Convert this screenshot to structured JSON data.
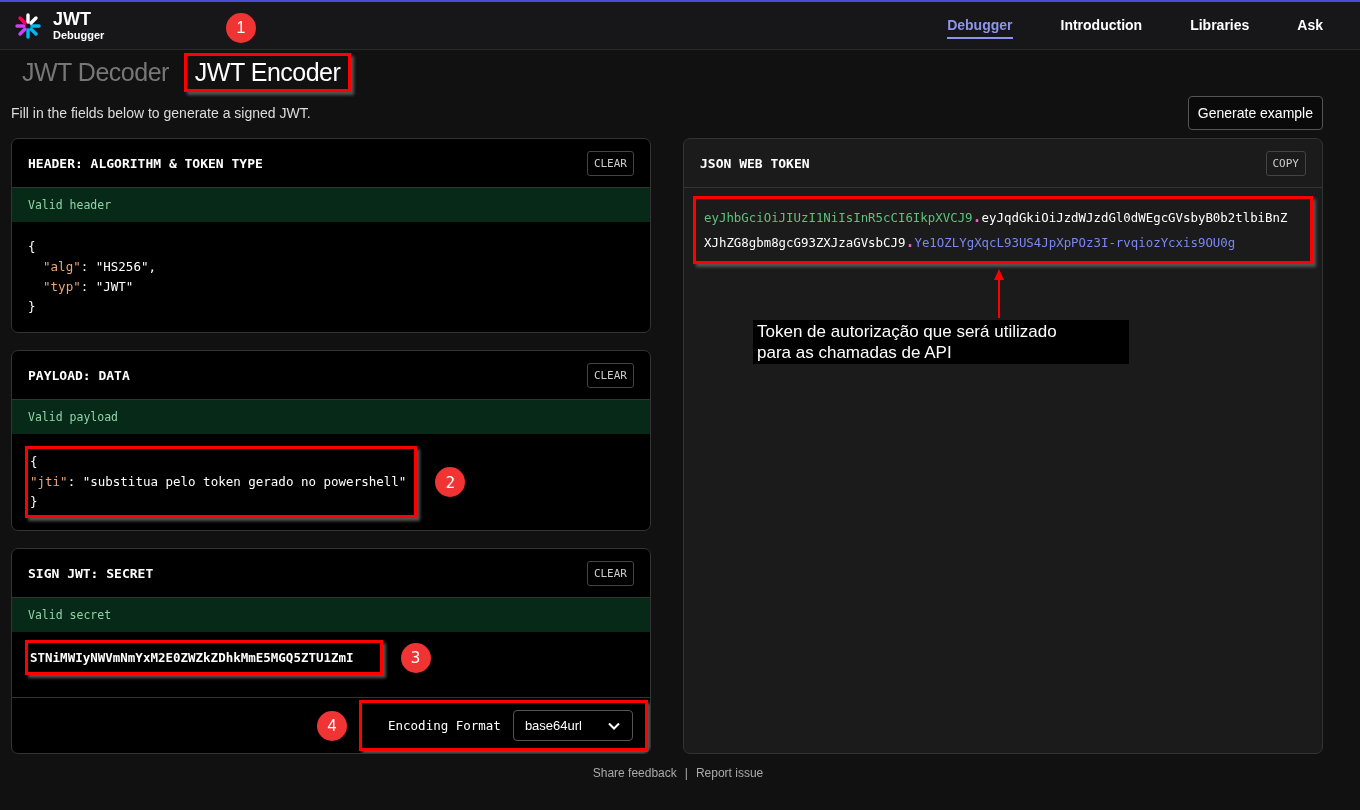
{
  "brand": {
    "title": "JWT",
    "subtitle": "Debugger"
  },
  "nav": [
    {
      "label": "Debugger",
      "selected": true
    },
    {
      "label": "Introduction",
      "selected": false
    },
    {
      "label": "Libraries",
      "selected": false
    },
    {
      "label": "Ask",
      "selected": false
    }
  ],
  "tabs": [
    {
      "label": "JWT Decoder",
      "selected": false,
      "highlighted": false
    },
    {
      "label": "JWT Encoder",
      "selected": true,
      "highlighted": true,
      "marker": "1"
    }
  ],
  "intro": "Fill in the fields below to generate a signed JWT.",
  "generate_button": "Generate example",
  "panels": [
    {
      "kind": "code",
      "title": "HEADER: ALGORITHM & TOKEN TYPE",
      "clear": "CLEAR",
      "status": "Valid header",
      "highlighted": false,
      "lines": [
        [
          {
            "t": "{",
            "kind": "punct"
          }
        ],
        [
          {
            "t": "  \"alg\"",
            "kind": "key"
          },
          {
            "t": ": ",
            "kind": "punct"
          },
          {
            "t": "\"HS256\"",
            "kind": "string"
          },
          {
            "t": ",",
            "kind": "punct"
          }
        ],
        [
          {
            "t": "  \"typ\"",
            "kind": "key"
          },
          {
            "t": ": ",
            "kind": "punct"
          },
          {
            "t": "\"JWT\"",
            "kind": "string"
          }
        ],
        [
          {
            "t": "}",
            "kind": "punct"
          }
        ]
      ]
    },
    {
      "kind": "code",
      "title": "PAYLOAD: DATA",
      "clear": "CLEAR",
      "status": "Valid payload",
      "highlighted": true,
      "marker": "2",
      "lines": [
        [
          {
            "t": "{",
            "kind": "punct"
          }
        ],
        [
          {
            "t": "\"jti\"",
            "kind": "key"
          },
          {
            "t": ": ",
            "kind": "punct"
          },
          {
            "t": "\"substitua pelo token gerado no powershell\"",
            "kind": "string"
          }
        ],
        [
          {
            "t": "}",
            "kind": "punct"
          }
        ]
      ]
    },
    {
      "kind": "secret",
      "title": "SIGN JWT: SECRET",
      "clear": "CLEAR",
      "status": "Valid secret",
      "highlighted": true,
      "marker": "3",
      "value": "STNiMWIyNWVmNmYxM2E0ZWZkZDhkMmE5MGQ5ZTU1ZmI",
      "encoding": {
        "label": "Encoding Format",
        "value": "base64url",
        "highlighted": true,
        "marker": "4"
      }
    }
  ],
  "token": {
    "title": "JSON WEB TOKEN",
    "copy": "COPY",
    "highlighted": true,
    "segments": [
      {
        "text": "eyJhbGciOiJIUzI1NiIsInR5cCI6IkpXVCJ9",
        "color": "#5fc27e"
      },
      {
        "text": ".",
        "color": "#f060c0"
      },
      {
        "text": "eyJqdGkiOiJzdWJzdGl0dWEgcGVsbyB0b2tlbiBnZXJhZG8gbm8gcG93ZXJzaGVsbCJ9",
        "color": "#ffffff"
      },
      {
        "text": ".",
        "color": "#f060c0"
      },
      {
        "text": "Ye1OZLYgXqcL93US4JpXpPOz3I-rvqiozYcxis9OU0g",
        "color": "#7a88f0"
      }
    ],
    "note": "Token de autorização que será utilizado\npara as chamadas de API"
  },
  "footer": {
    "links": [
      "Share feedback",
      "Report issue"
    ],
    "separator": "|"
  }
}
